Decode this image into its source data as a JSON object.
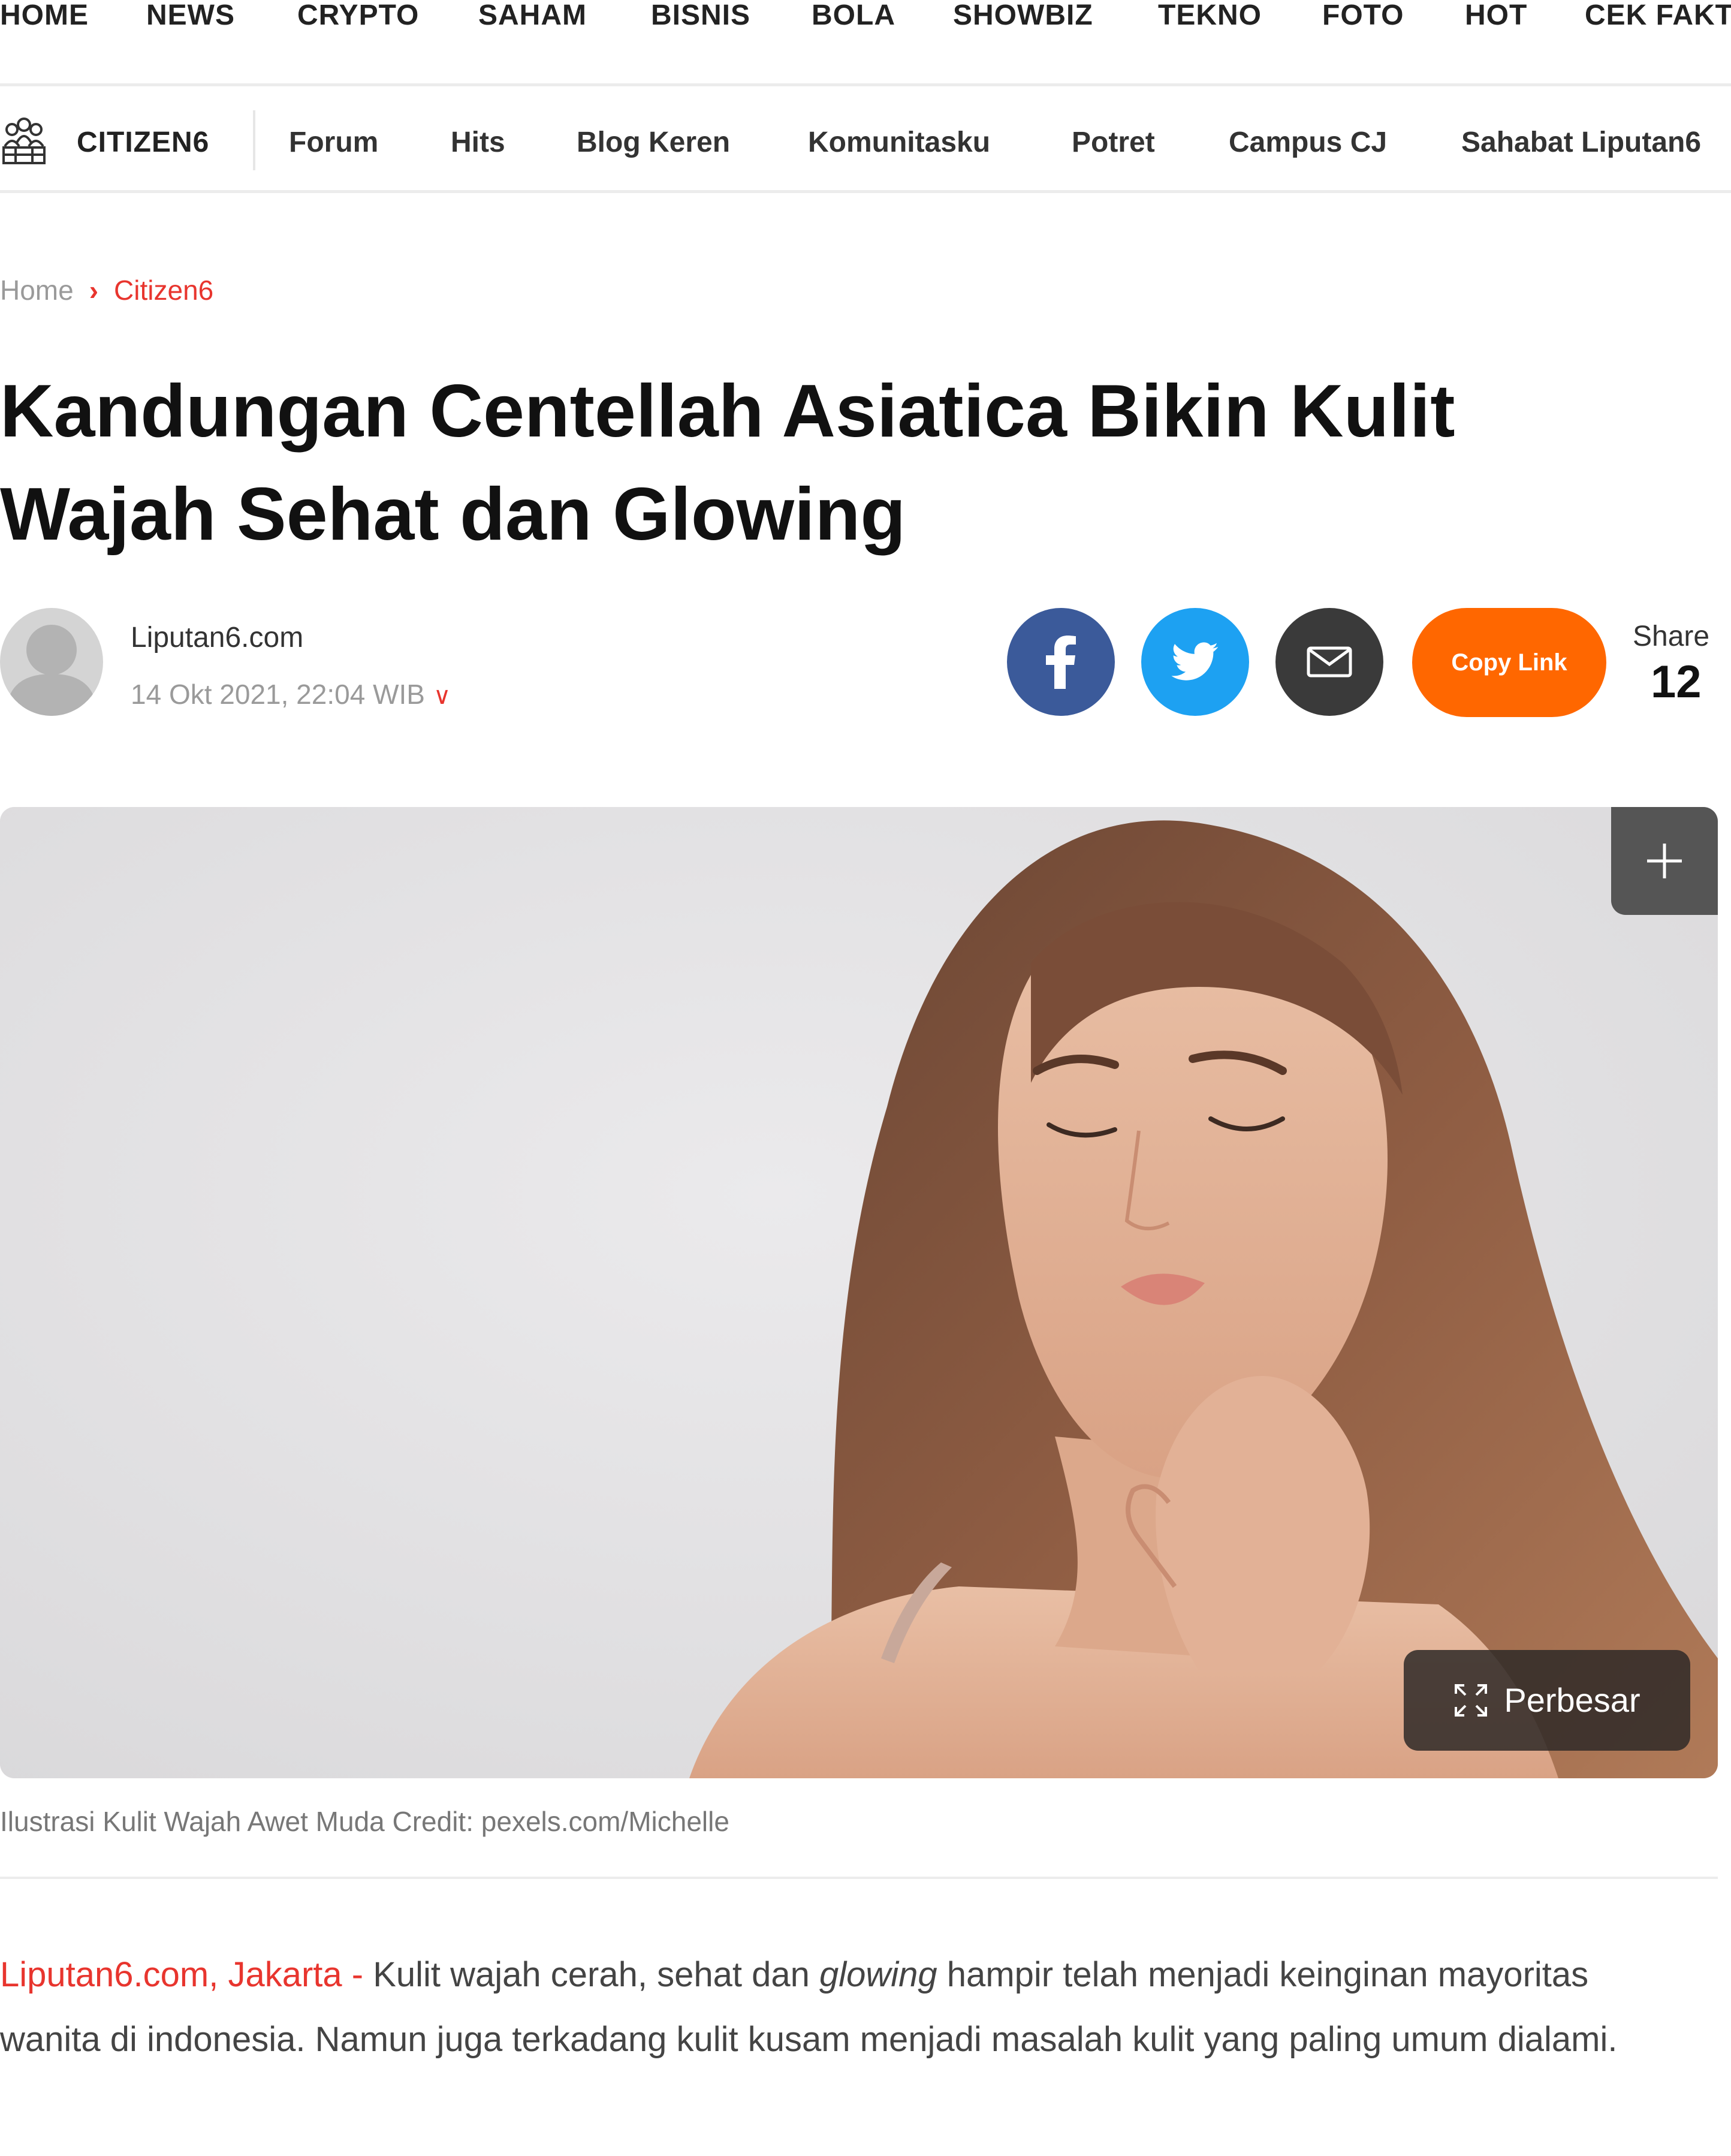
{
  "top_nav": [
    "HOME",
    "NEWS",
    "CRYPTO",
    "SAHAM",
    "BISNIS",
    "BOLA",
    "SHOWBIZ",
    "TEKNO",
    "FOTO",
    "HOT",
    "CEK FAKT"
  ],
  "sub_nav": {
    "brand": "CITIZEN6",
    "items": [
      "Forum",
      "Hits",
      "Blog Keren",
      "Komunitasku",
      "Potret",
      "Campus CJ",
      "Sahabat Liputan6"
    ]
  },
  "breadcrumb": {
    "home": "Home",
    "current": "Citizen6"
  },
  "article": {
    "title": "Kandungan Centellah Asiatica Bikin Kulit Wajah Sehat dan Glowing",
    "author": "Liputan6.com",
    "date": "14 Okt 2021, 22:04 WIB",
    "copy_link": "Copy Link",
    "share_label": "Share",
    "share_count": "12",
    "enlarge_label": "Perbesar",
    "caption": "Ilustrasi Kulit Wajah Awet Muda Credit: pexels.com/Michelle",
    "dateline": "Liputan6.com, Jakarta - ",
    "body_part1": "Kulit wajah cerah, sehat dan ",
    "body_italic": "glowing",
    "body_part2": " hampir telah menjadi keinginan mayoritas wanita di indonesia. Namun juga terkadang kulit kusam menjadi masalah kulit yang paling umum dialami."
  },
  "share_buttons": [
    {
      "name": "facebook",
      "icon": "facebook-icon",
      "color": "#3b5a9a"
    },
    {
      "name": "twitter",
      "icon": "twitter-icon",
      "color": "#1da1f2"
    },
    {
      "name": "email",
      "icon": "mail-icon",
      "color": "#3a3a3a"
    }
  ],
  "colors": {
    "accent": "#e8352e",
    "copy_link": "#ff6700"
  }
}
